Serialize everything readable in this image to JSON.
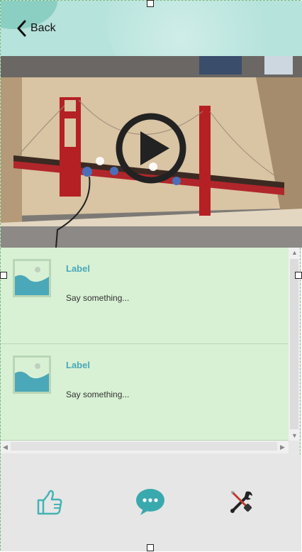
{
  "header": {
    "back_label": "Back"
  },
  "video": {
    "play_icon": "play-icon"
  },
  "list": {
    "items": [
      {
        "label": "Label",
        "text": "Say something...",
        "icon": "image-placeholder-icon"
      },
      {
        "label": "Label",
        "text": "Say something...",
        "icon": "image-placeholder-icon"
      }
    ]
  },
  "toolbar": {
    "like_icon": "thumbs-up-icon",
    "comment_icon": "chat-bubble-icon",
    "tools_icon": "wrench-screwdriver-icon"
  },
  "colors": {
    "header_bg": "#b6e3dc",
    "list_bg": "#d8f1d4",
    "accent": "#4aa8b8"
  }
}
